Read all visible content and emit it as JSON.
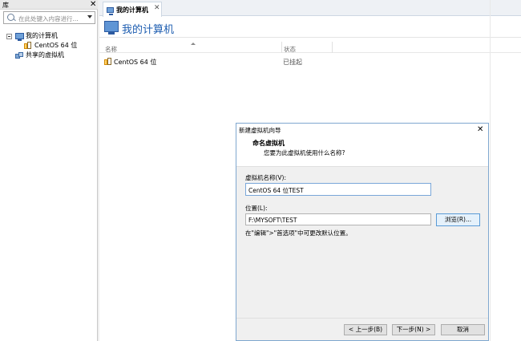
{
  "library": {
    "title": "库",
    "close_glyph": "✕",
    "search_placeholder": "在此处键入内容进行...",
    "tree": {
      "my_computer": "我的计算机",
      "centos": "CentOS 64 位",
      "shared": "共享的虚拟机"
    }
  },
  "tabs": [
    {
      "label": "我的计算机",
      "close_glyph": "✕"
    }
  ],
  "main": {
    "title": "我的计算机",
    "columns": {
      "name": "名称",
      "status": "状态"
    },
    "rows": [
      {
        "name": "CentOS 64 位",
        "status": "已挂起"
      }
    ]
  },
  "dialog": {
    "title": "新建虚拟机向导",
    "close_glyph": "✕",
    "heading": "命名虚拟机",
    "subheading": "您要为此虚拟机使用什么名称?",
    "name_label": "虚拟机名称(V):",
    "name_value": "CentOS 64 位TEST",
    "location_label": "位置(L):",
    "location_value": "F:\\MYSOFT\\TEST",
    "browse_label": "浏览(R)...",
    "hint": "在\"编辑\">\"首选项\"中可更改默认位置。",
    "buttons": {
      "back": "< 上一步(B)",
      "next": "下一步(N) >",
      "cancel": "取消"
    }
  }
}
